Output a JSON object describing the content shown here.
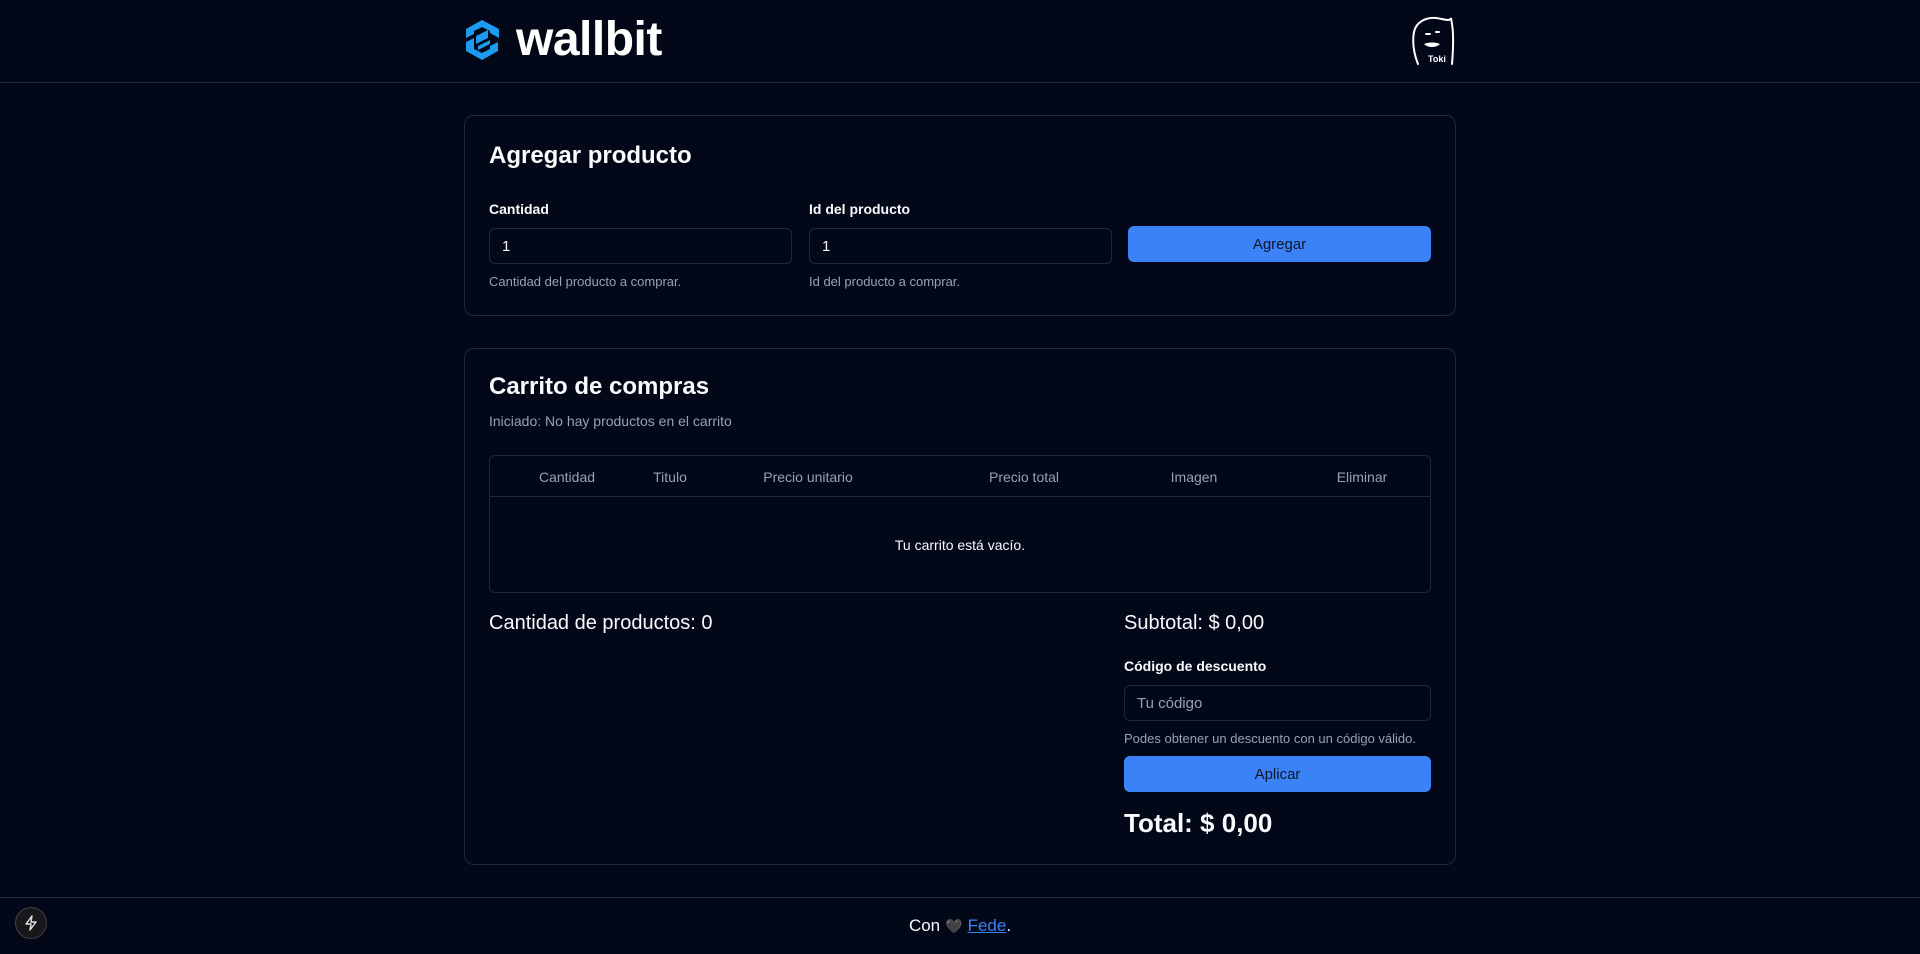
{
  "header": {
    "logo_text": "wallbit",
    "brand_color": "#1d9bf0"
  },
  "add_product": {
    "title": "Agregar producto",
    "quantity_label": "Cantidad",
    "quantity_value": "1",
    "quantity_hint": "Cantidad del producto a comprar.",
    "product_id_label": "Id del producto",
    "product_id_value": "1",
    "product_id_hint": "Id del producto a comprar.",
    "add_button": "Agregar"
  },
  "cart": {
    "title": "Carrito de compras",
    "subtitle": "Iniciado: No hay productos en el carrito",
    "columns": [
      "Cantidad",
      "Titulo",
      "Precio unitario",
      "Precio total",
      "Imagen",
      "Eliminar"
    ],
    "empty_message": "Tu carrito está vacío.",
    "product_count": "Cantidad de productos: 0",
    "subtotal": "Subtotal: $ 0,00",
    "discount_label": "Código de descuento",
    "discount_placeholder": "Tu código",
    "discount_hint": "Podes obtener un descuento con un código válido.",
    "apply_button": "Aplicar",
    "total": "Total: $ 0,00"
  },
  "footer": {
    "prefix": "Con",
    "heart": "🖤",
    "author": "Fede",
    "suffix": "."
  },
  "colors": {
    "background": "#020817",
    "border": "#1e293b",
    "accent": "#3b82f6",
    "muted_text": "#94a3b8"
  }
}
